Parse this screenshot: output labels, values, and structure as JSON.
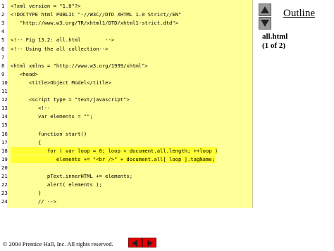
{
  "outline": {
    "title": "Outline",
    "file_name": "all.html",
    "page": "(1 of 2)"
  },
  "footer": {
    "copyright": "© 2004 Prentice Hall, Inc.  All rights reserved."
  },
  "icons": {
    "up": "triangle-up-icon",
    "down": "triangle-down-icon",
    "prev": "arrow-left-icon",
    "next": "arrow-right-icon"
  },
  "code_lines": [
    {
      "n": "1",
      "t": "<?xml version = \"1.0\"?>"
    },
    {
      "n": "2",
      "t": "<!DOCTYPE html PUBLIC \"-//W3C//DTD XHTML 1.0 Strict//EN\""
    },
    {
      "n": "3",
      "t": "   \"http://www.w3.org/TR/xhtml1/DTD/xhtml1-strict.dtd\">"
    },
    {
      "n": "4",
      "t": ""
    },
    {
      "n": "5",
      "t": "<!-- Fig 13.2: all.html        -->"
    },
    {
      "n": "6",
      "t": "<!-- Using the all collection-->"
    },
    {
      "n": "7",
      "t": ""
    },
    {
      "n": "8",
      "t": "<html xmlns = \"http://www.w3.org/1999/xhtml\">"
    },
    {
      "n": "9",
      "t": "   <head>"
    },
    {
      "n": "10",
      "t": "      <title>Object Model</title>"
    },
    {
      "n": "11",
      "t": ""
    },
    {
      "n": "12",
      "t": "      <script type = \"text/javascript\">"
    },
    {
      "n": "13",
      "t": "         <!--"
    },
    {
      "n": "14",
      "t": "         var elements = \"\";"
    },
    {
      "n": "15",
      "t": ""
    },
    {
      "n": "16",
      "t": "         function start()"
    },
    {
      "n": "17",
      "t": "         {"
    },
    {
      "n": "18",
      "t": "            for ( var loop = 0; loop < document.all.length; ++loop )"
    },
    {
      "n": "19",
      "t": "               elements += \"<br />\" + document.all[ loop ].tagName;"
    },
    {
      "n": "20",
      "t": ""
    },
    {
      "n": "21",
      "t": "            pText.innerHTML += elements;"
    },
    {
      "n": "22",
      "t": "            alert( elements );"
    },
    {
      "n": "23",
      "t": "         }"
    },
    {
      "n": "24",
      "t": "         // -->"
    }
  ]
}
